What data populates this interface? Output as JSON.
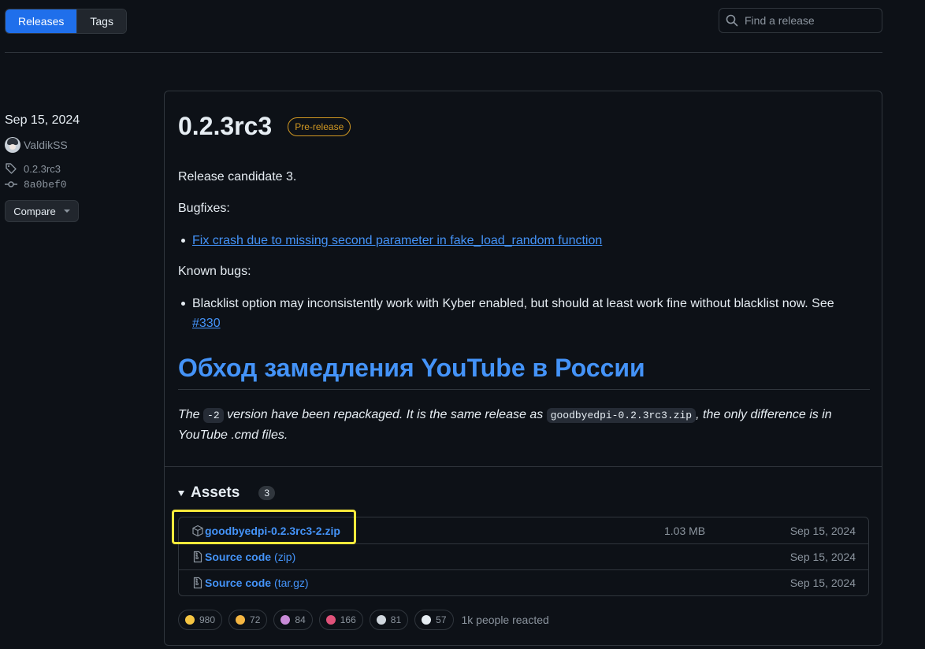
{
  "nav": {
    "tabs": [
      {
        "label": "Releases"
      },
      {
        "label": "Tags"
      }
    ],
    "search_placeholder": "Find a release"
  },
  "sidebar": {
    "date": "Sep 15, 2024",
    "author": "ValdikSS",
    "tag": "0.2.3rc3",
    "commit": "8a0bef0",
    "compare_label": "Compare"
  },
  "release": {
    "title": "0.2.3rc3",
    "badge": "Pre-release",
    "intro": "Release candidate 3.",
    "bugfixes_heading": "Bugfixes:",
    "bugfix_link": "Fix crash due to missing second parameter in fake_load_random function",
    "known_bugs_heading": "Known bugs:",
    "known_bug_text": "Blacklist option may inconsistently work with Kyber enabled, but should at least work fine without blacklist now. See",
    "known_bug_link": "#330",
    "section_heading": "Обход замедления YouTube в России",
    "note_prefix": "The",
    "note_code1": "-2",
    "note_mid": "version have been repackaged. It is the same release as",
    "note_code2": "goodbyedpi-0.2.3rc3.zip",
    "note_suffix": ", the only difference is in YouTube .cmd files."
  },
  "assets": {
    "heading": "Assets",
    "count": "3",
    "items": [
      {
        "name": "goodbyedpi-0.2.3rc3-2.zip",
        "sub": "",
        "size": "1.03 MB",
        "date": "Sep 15, 2024",
        "icon": "package-icon"
      },
      {
        "name": "Source code",
        "sub": "(zip)",
        "size": "",
        "date": "Sep 15, 2024",
        "icon": "file-zip-icon"
      },
      {
        "name": "Source code",
        "sub": "(tar.gz)",
        "size": "",
        "date": "Sep 15, 2024",
        "icon": "file-zip-icon"
      }
    ]
  },
  "reactions": {
    "items": [
      {
        "emoji": "thumbs-up",
        "count": "980",
        "color": "#f5c542"
      },
      {
        "emoji": "laugh",
        "count": "72",
        "color": "#f5b642"
      },
      {
        "emoji": "hooray",
        "count": "84",
        "color": "#c98bd8"
      },
      {
        "emoji": "heart",
        "count": "166",
        "color": "#e0527a"
      },
      {
        "emoji": "rocket",
        "count": "81",
        "color": "#d0d7de"
      },
      {
        "emoji": "eyes",
        "count": "57",
        "color": "#e6edf3"
      }
    ],
    "summary": "1k people reacted"
  },
  "colors": {
    "accent": "#1f6feb",
    "link": "#4493f8",
    "prerelease": "#d29922",
    "highlight": "#f7e93b"
  }
}
